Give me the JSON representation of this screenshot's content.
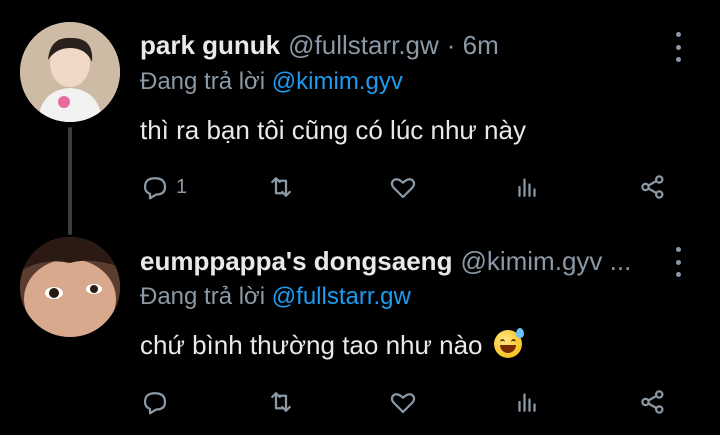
{
  "tweets": [
    {
      "display_name": "park gunuk",
      "handle": "@fullstarr.gw",
      "meta": "· 6m",
      "reply_prefix": "Đang trả lời",
      "reply_to": "@kimim.gyv",
      "text": "thì ra bạn tôi cũng có lúc như này",
      "reply_count": "1",
      "avatar_icon": "profile-photo"
    },
    {
      "display_name": "eumppappa's dongsaeng",
      "handle": "@kimim.gyv ...",
      "reply_prefix": "Đang trả lời",
      "reply_to": "@fullstarr.gw",
      "text": "chứ bình thường tao như nào",
      "emoji": "sweat-smile-emoji",
      "reply_count": "",
      "avatar_icon": "profile-photo"
    }
  ],
  "colors": {
    "background": "#000000",
    "text": "#e7e9ea",
    "muted": "#8b98a5",
    "link": "#1d9bf0"
  }
}
